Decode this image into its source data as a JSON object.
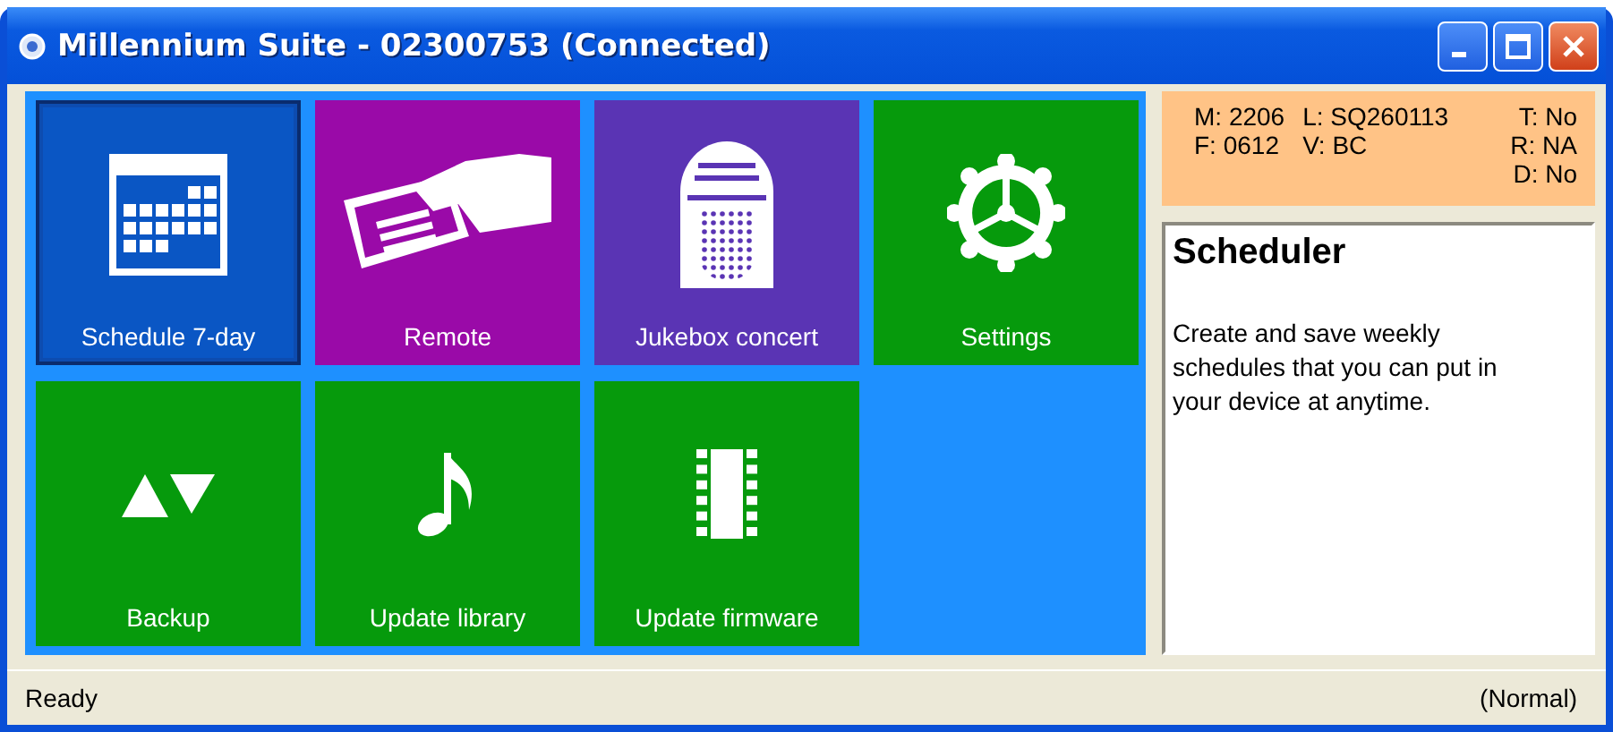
{
  "window": {
    "title": "Millennium Suite - 02300753 (Connected)",
    "controls": [
      {
        "kind": "minimize"
      },
      {
        "kind": "maximize"
      },
      {
        "kind": "close"
      }
    ]
  },
  "tiles": [
    {
      "label": "Schedule 7-day",
      "kind": "calendar",
      "color": "#0a56c4",
      "selected": true
    },
    {
      "label": "Remote",
      "kind": "remote",
      "color": "#9a0aa8",
      "selected": false
    },
    {
      "label": "Jukebox concert",
      "kind": "jukebox",
      "color": "#5a34b4",
      "selected": false
    },
    {
      "label": "Settings",
      "kind": "gear",
      "color": "#069a0c",
      "selected": false
    },
    {
      "label": "Backup",
      "kind": "updown",
      "color": "#069a0c",
      "selected": false
    },
    {
      "label": "Update library",
      "kind": "note",
      "color": "#069a0c",
      "selected": false
    },
    {
      "label": "Update firmware",
      "kind": "chip",
      "color": "#069a0c",
      "selected": false
    }
  ],
  "info": {
    "rows": [
      [
        "M: 2206",
        "L: SQ260113"
      ],
      [
        "F: 0612",
        "V: BC"
      ]
    ],
    "flags": [
      "T: No",
      "R: NA",
      "D: No"
    ]
  },
  "description": {
    "title": "Scheduler",
    "text": "Create and save weekly schedules that you can put in your device at anytime."
  },
  "status_bar": {
    "left": "Ready",
    "right": "(Normal)"
  }
}
